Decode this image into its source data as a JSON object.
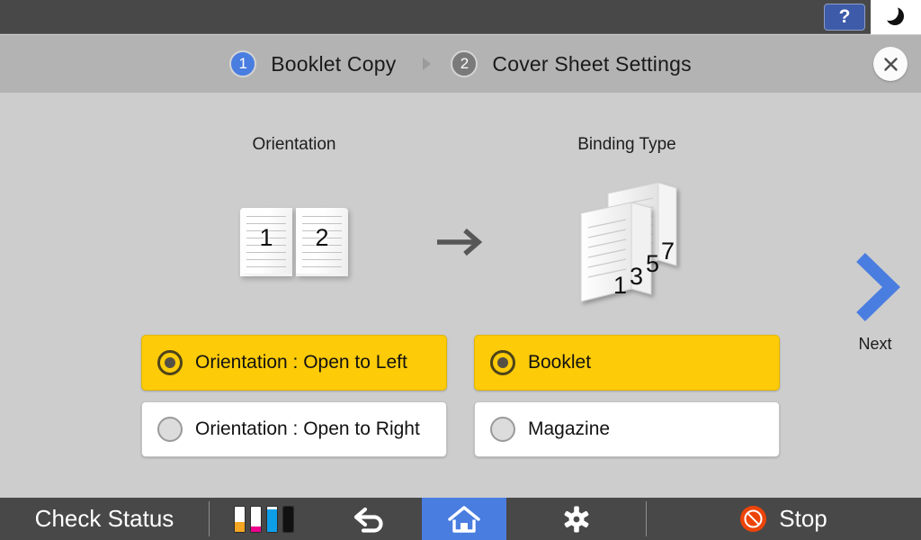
{
  "system_bar": {
    "help_label": "?",
    "help_icon": "question-mark-icon",
    "night_icon": "moon-icon"
  },
  "wizard": {
    "steps": [
      {
        "number": "1",
        "label": "Booklet Copy",
        "state": "active"
      },
      {
        "number": "2",
        "label": "Cover Sheet Settings",
        "state": "inactive"
      }
    ],
    "separator_icon": "chevron-right-icon",
    "close_icon": "close-icon"
  },
  "main": {
    "orientation_section": {
      "title": "Orientation",
      "preview_icon": "open-book-icon",
      "preview_pages": [
        "1",
        "2"
      ],
      "options": [
        {
          "label": "Orientation : Open to Left",
          "selected": true
        },
        {
          "label": "Orientation : Open to Right",
          "selected": false
        }
      ]
    },
    "transition_icon": "arrow-right-icon",
    "binding_section": {
      "title": "Binding Type",
      "preview_icon": "folded-sheets-icon",
      "preview_pages": [
        "1",
        "3",
        "5",
        "7"
      ],
      "options": [
        {
          "label": "Booklet",
          "selected": true
        },
        {
          "label": "Magazine",
          "selected": false
        }
      ]
    },
    "next": {
      "label": "Next",
      "icon": "chevron-right-icon"
    }
  },
  "bottom_bar": {
    "check_status_label": "Check Status",
    "toner_icon": "toner-levels-icon",
    "toner_levels": [
      {
        "color": "#f5a623",
        "name": "yellow",
        "percent": 36
      },
      {
        "color": "#ec008c",
        "name": "magenta",
        "percent": 20
      },
      {
        "color": "#0d9ee8",
        "name": "cyan",
        "percent": 88
      },
      {
        "color": "#111111",
        "name": "black",
        "percent": 100
      }
    ],
    "back_icon": "back-arrow-icon",
    "home_icon": "home-icon",
    "settings_icon": "gear-icon",
    "stop_icon": "stop-icon",
    "stop_label": "Stop"
  },
  "colors": {
    "accent_blue": "#4a7de0",
    "selected_yellow": "#fdcb08",
    "bar_dark": "#484848",
    "header_gray": "#b3b3b3",
    "panel_gray": "#cdcdcd",
    "stop_red": "#ec4409"
  }
}
